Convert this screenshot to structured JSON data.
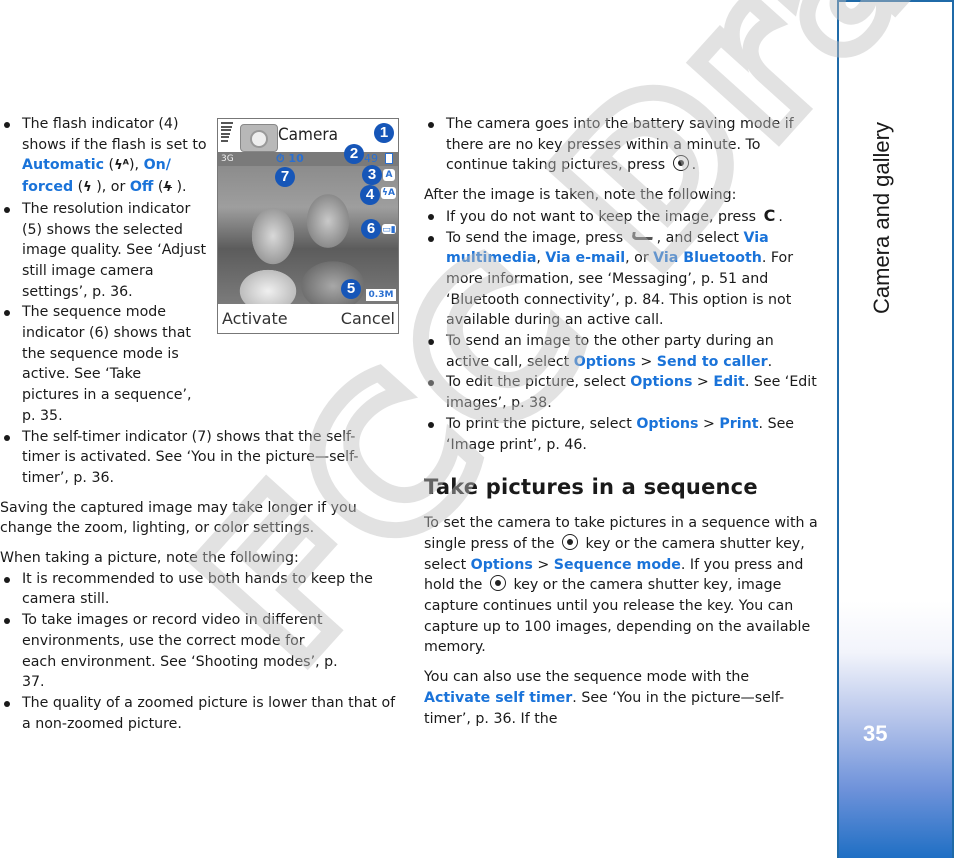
{
  "side_tab": {
    "title": "Camera and gallery",
    "page_number": "35"
  },
  "watermark": "FCC Draft",
  "phone_screen": {
    "title": "Camera",
    "network": "3G",
    "self_timer_value": "10",
    "images_remaining": "49",
    "left_softkey": "Activate",
    "right_softkey": "Cancel",
    "indicators": {
      "capture_mode": "A",
      "flash": "ϟA",
      "resolution": "0.3M"
    },
    "callouts": [
      "1",
      "2",
      "3",
      "4",
      "5",
      "6",
      "7"
    ]
  },
  "left_column": {
    "bullets_top": [
      {
        "parts": [
          "The flash indicator (4) shows if the flash is set to ",
          "Automatic",
          " (",
          "⚡A",
          "), ",
          "On/ forced",
          " (",
          "⚡",
          " ), or ",
          "Off",
          " (",
          "⚡̸",
          " )."
        ]
      },
      {
        "text": "The resolution indicator (5) shows the selected image quality. See ‘Adjust still image camera settings’, p. 36."
      },
      {
        "text": "The sequence mode indicator (6) shows that the sequence mode is active. See ‘Take pictures in a sequence’, p. 35."
      },
      {
        "text": "The self-timer indicator (7) shows that the self-timer is activated. See ‘You in the picture—self-timer’, p. 36."
      }
    ],
    "para_saving": "Saving the captured image may take longer if you change the zoom, lighting, or color settings.",
    "para_note": "When taking a picture, note the following:",
    "bullets_note": [
      "It is recommended to use both hands to keep the camera still.",
      "To take images or record video in different environments, use the correct mode for each environment. See ‘Shooting modes’, p. 37.",
      "The quality of a zoomed picture is lower than that of a non-zoomed picture."
    ]
  },
  "right_column": {
    "bullet_battery": {
      "before": "The camera goes into the battery saving mode if there are no key presses within a minute. To continue taking pictures, press ",
      "after": "."
    },
    "para_after": "After the image is taken, note the following:",
    "bullet_delete": {
      "before": "If you do not want to keep the image, press ",
      "key": "C",
      "after": "."
    },
    "bullet_send": {
      "before": "To send the image, press ",
      "mid": ", and select ",
      "link1": "Via multimedia",
      "sep1": ", ",
      "link2": "Via e-mail",
      "sep2": ", or ",
      "link3": "Via Bluetooth",
      "after": ". For more information, see ‘Messaging’, p. 51 and ‘Bluetooth connectivity’, p. 84. This option is not available during an active call."
    },
    "bullet_caller": {
      "before": "To send an image to the other party during an active call, select ",
      "link1": "Options",
      "sep": " > ",
      "link2": "Send to caller",
      "after": "."
    },
    "bullet_edit": {
      "before": "To edit the picture, select ",
      "link1": "Options",
      "sep": " > ",
      "link2": "Edit",
      "after": ". See ‘Edit images’, p. 38."
    },
    "bullet_print": {
      "before": "To print the picture, select ",
      "link1": "Options",
      "sep": " > ",
      "link2": "Print",
      "after": ". See ‘Image print’, p. 46."
    },
    "section_heading": "Take pictures in a sequence",
    "para_sequence": {
      "t1": "To set the camera to take pictures in a sequence with a single press of the ",
      "t2": " key or the camera shutter key, select ",
      "link1": "Options",
      "sep": " > ",
      "link2": "Sequence mode",
      "t3": ". If you press and hold the ",
      "t4": " key or the camera shutter key, image capture continues until you release the key. You can capture up to 100 images, depending on the available memory."
    },
    "para_selftimer": {
      "before": "You can also use the sequence mode with the ",
      "link": "Activate self timer",
      "after": ". See ‘You in the picture—self-timer’, p. 36. If the"
    }
  }
}
